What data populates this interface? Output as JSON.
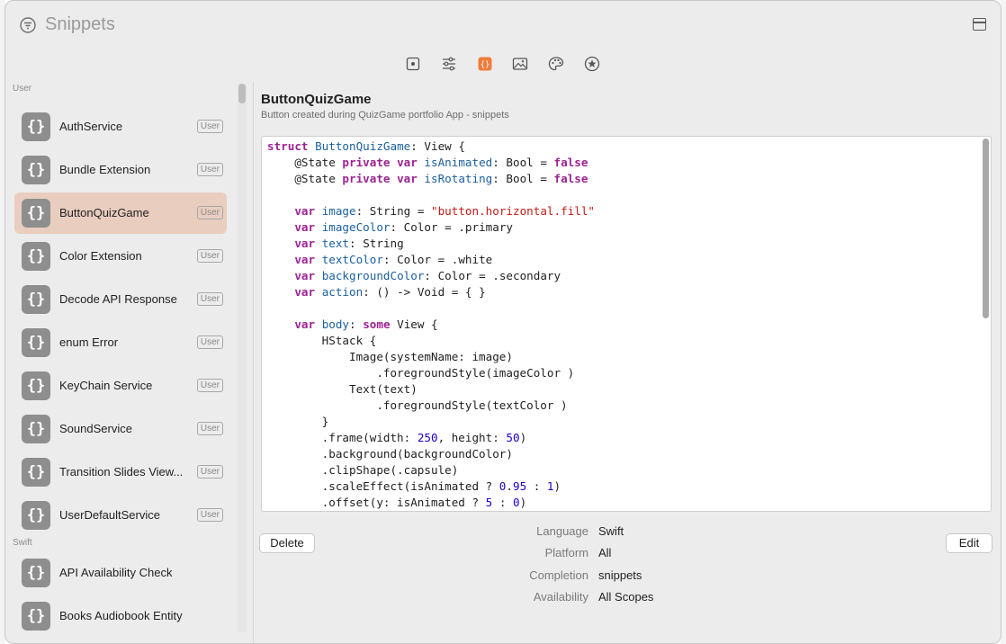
{
  "window": {
    "title": "Snippets"
  },
  "sidebar": {
    "sections": [
      {
        "label": "User",
        "items": [
          {
            "label": "AuthService",
            "badge": "User",
            "selected": false
          },
          {
            "label": "Bundle Extension",
            "badge": "User",
            "selected": false
          },
          {
            "label": "ButtonQuizGame",
            "badge": "User",
            "selected": true
          },
          {
            "label": "Color Extension",
            "badge": "User",
            "selected": false
          },
          {
            "label": "Decode API Response",
            "badge": "User",
            "selected": false
          },
          {
            "label": "enum Error",
            "badge": "User",
            "selected": false
          },
          {
            "label": "KeyChain Service",
            "badge": "User",
            "selected": false
          },
          {
            "label": "SoundService",
            "badge": "User",
            "selected": false
          },
          {
            "label": "Transition Slides View...",
            "badge": "User",
            "selected": false
          },
          {
            "label": "UserDefaultService",
            "badge": "User",
            "selected": false
          }
        ]
      },
      {
        "label": "Swift",
        "items": [
          {
            "label": "API Availability Check",
            "selected": false
          },
          {
            "label": "Books Audiobook Entity",
            "selected": false
          }
        ]
      }
    ],
    "item_icon": "{}"
  },
  "toolbar": {
    "icons": [
      "file-icon",
      "sliders-icon",
      "code-snippet-icon",
      "image-icon",
      "palette-icon",
      "star-icon"
    ],
    "active": "code-snippet-icon",
    "accent": "#f07c3a"
  },
  "detail": {
    "title": "ButtonQuizGame",
    "subtitle": "Button created during QuizGame portfolio App - snippets",
    "code": [
      "struct ButtonQuizGame: View {",
      "    @State private var isAnimated: Bool = false",
      "    @State private var isRotating: Bool = false",
      "",
      "    var image: String = \"button.horizontal.fill\"",
      "    var imageColor: Color = .primary",
      "    var text: String",
      "    var textColor: Color = .white",
      "    var backgroundColor: Color = .secondary",
      "    var action: () -> Void = { }",
      "",
      "    var body: some View {",
      "        HStack {",
      "            Image(systemName: image)",
      "                .foregroundStyle(imageColor )",
      "            Text(text)",
      "                .foregroundStyle(textColor )",
      "        }",
      "        .frame(width: 250, height: 50)",
      "        .background(backgroundColor)",
      "        .clipShape(.capsule)",
      "        .scaleEffect(isAnimated ? 0.95 : 1)",
      "        .offset(y: isAnimated ? 5 : 0)"
    ],
    "meta": [
      {
        "key": "Language",
        "value": "Swift"
      },
      {
        "key": "Platform",
        "value": "All"
      },
      {
        "key": "Completion",
        "value": "snippets"
      },
      {
        "key": "Availability",
        "value": "All Scopes"
      }
    ],
    "delete_label": "Delete",
    "edit_label": "Edit"
  },
  "colors": {
    "selected_row": "#e9cdbf",
    "keyword": "#9b2393",
    "type": "#1a5f9e",
    "string": "#c41a16",
    "number": "#1c00cf"
  }
}
